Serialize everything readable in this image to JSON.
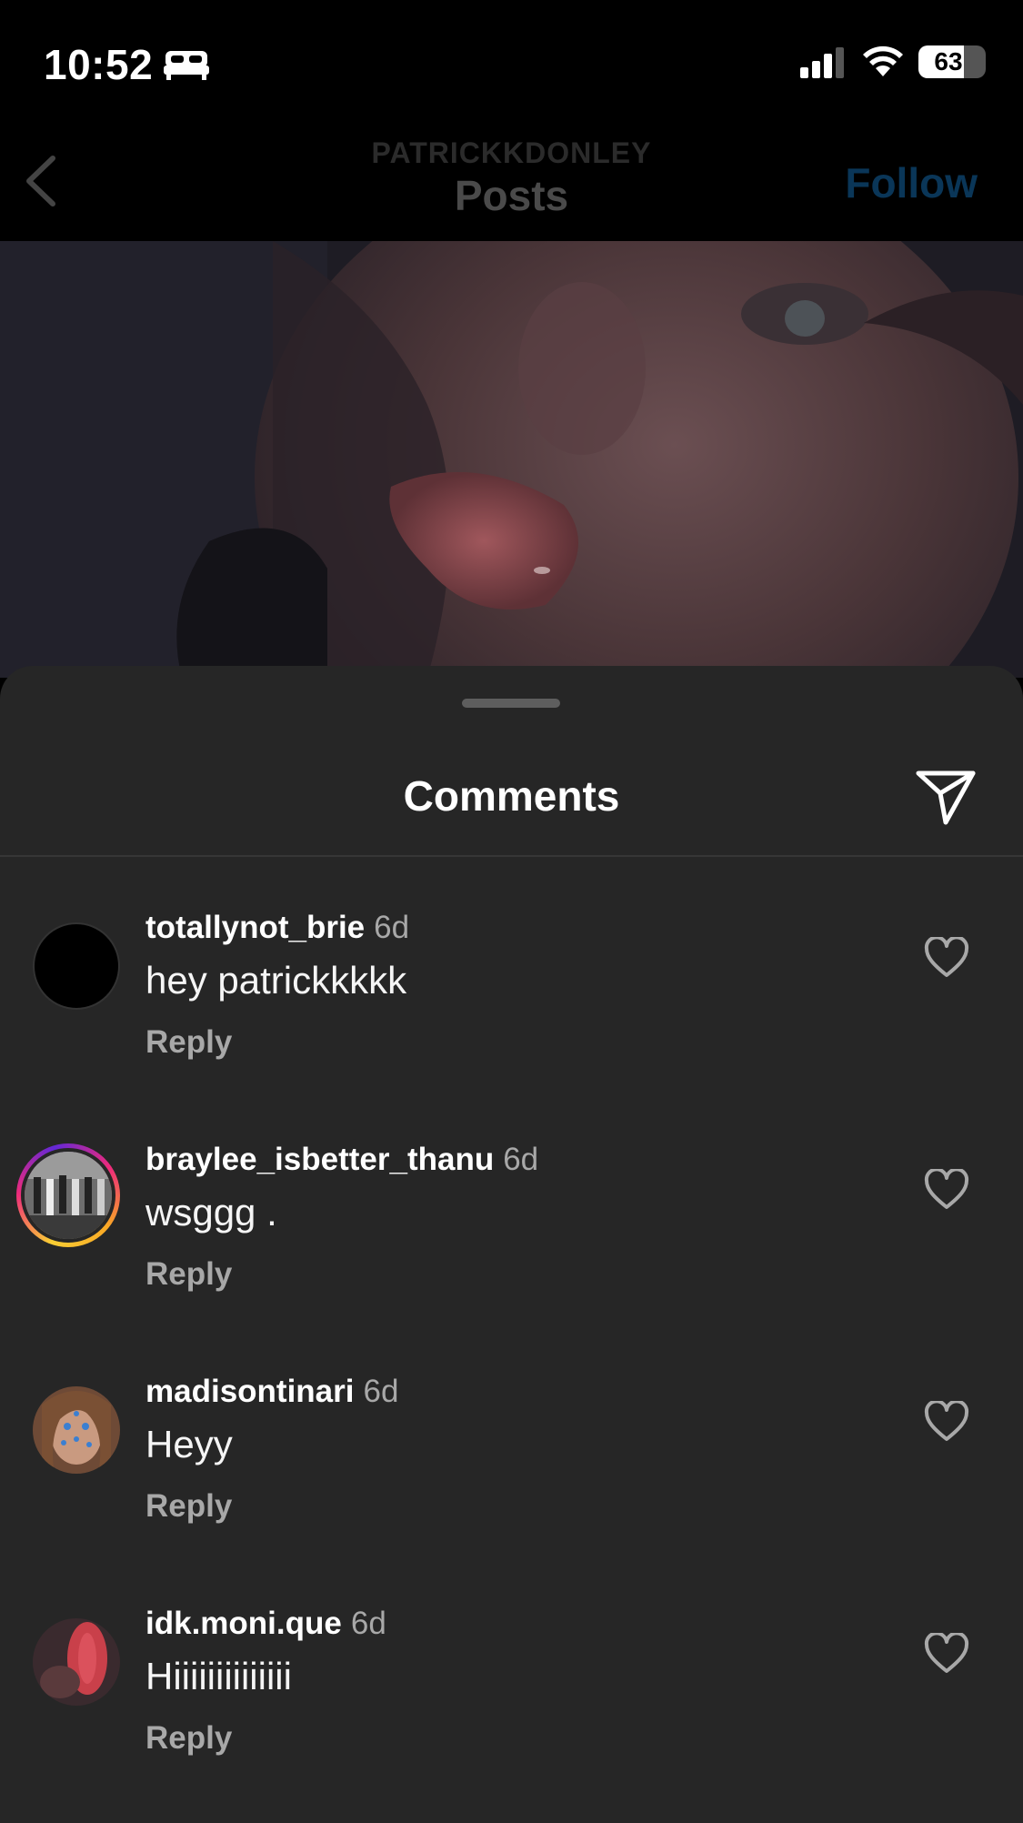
{
  "status_bar": {
    "time": "10:52",
    "battery": "63",
    "battery_fraction": 0.63,
    "icons": [
      "bed-icon",
      "signal-icon",
      "wifi-icon",
      "battery-icon"
    ]
  },
  "header": {
    "subtitle": "PATRICKKDONLEY",
    "title": "Posts",
    "follow_label": "Follow",
    "back_icon": "chevron-left-icon"
  },
  "sheet": {
    "title": "Comments",
    "share_icon": "send-icon"
  },
  "comments": [
    {
      "user": "totallynot_brie",
      "time": "6d",
      "text": "hey patrickkkkk",
      "reply": "Reply"
    },
    {
      "user": "braylee_isbetter_thanu",
      "time": "6d",
      "text": "wsggg .",
      "reply": "Reply"
    },
    {
      "user": "madisontinari",
      "time": "6d",
      "text": "Heyy",
      "reply": "Reply"
    },
    {
      "user": "idk.moni.que",
      "time": "6d",
      "text": "Hiiiiiiiiiiiiii",
      "reply": "Reply"
    }
  ],
  "colors": {
    "background": "#000000",
    "sheet": "#262626",
    "follow": "#0a3658",
    "muted_text": "#a8a8a8"
  }
}
